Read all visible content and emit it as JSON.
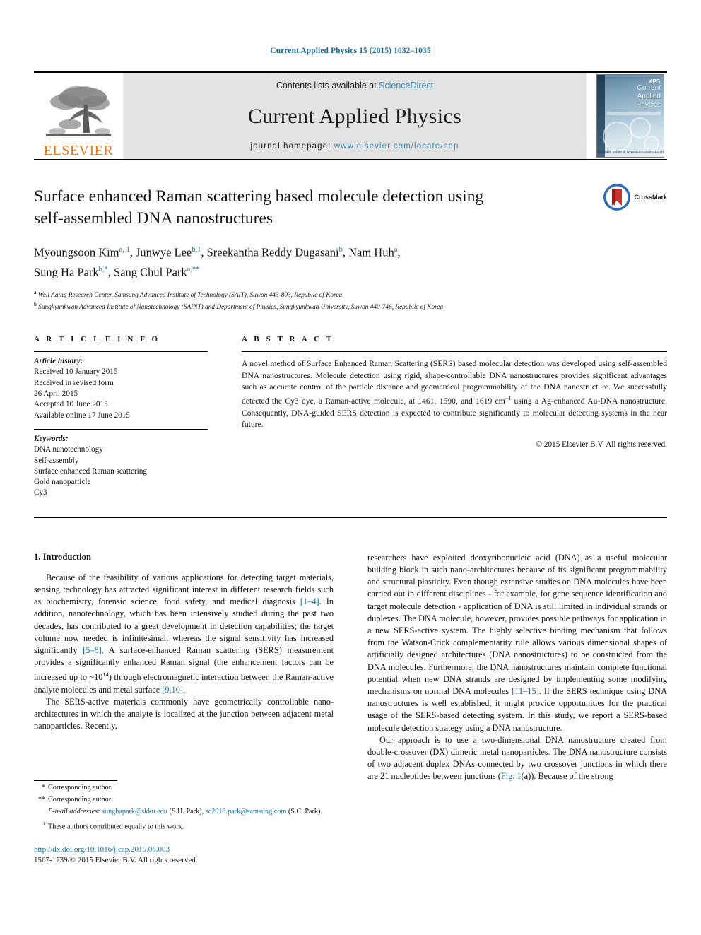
{
  "running_head": "Current Applied Physics 15 (2015) 1032–1035",
  "masthead": {
    "publisher_logo_text": "ELSEVIER",
    "contents_prefix": "Contents lists available at ",
    "contents_link": "ScienceDirect",
    "journal_name": "Current Applied Physics",
    "homepage_prefix": "journal homepage: ",
    "homepage_link": "www.elsevier.com/locate/cap",
    "cover": {
      "line1": "Current",
      "line2": "Applied",
      "line3": "Physics",
      "badge": "KPS",
      "footer": "Available online at www.sciencedirect.com"
    }
  },
  "article": {
    "title_line1": "Surface enhanced Raman scattering based molecule detection using",
    "title_line2": "self-assembled DNA nanostructures",
    "crossmark_label": "CrossMark",
    "authors_line1_parts": [
      {
        "name": "Myoungsoon Kim",
        "sup": "a, 1"
      },
      {
        "name": "Junwye Lee",
        "sup": "b,1"
      },
      {
        "name": "Sreekantha Reddy Dugasani",
        "sup": "b"
      },
      {
        "name": "Nam Huh",
        "sup": "a"
      }
    ],
    "authors_line2_parts": [
      {
        "name": "Sung Ha Park",
        "sup": "b,*"
      },
      {
        "name": "Sang Chul Park",
        "sup": "a,**"
      }
    ],
    "affiliations": [
      {
        "mark": "a",
        "text": "Well Aging Research Center, Samsung Advanced Institute of Technology (SAIT), Suwon 443-803, Republic of Korea"
      },
      {
        "mark": "b",
        "text": "Sungkyunkwan Advanced Institute of Nanotechnology (SAINT) and Department of Physics, Sungkyunkwan University, Suwon 440-746, Republic of Korea"
      }
    ]
  },
  "article_info": {
    "heading": "A R T I C L E   I N F O",
    "history_label": "Article history:",
    "history": [
      "Received 10 January 2015",
      "Received in revised form",
      "26 April 2015",
      "Accepted 10 June 2015",
      "Available online 17 June 2015"
    ],
    "keywords_label": "Keywords:",
    "keywords": [
      "DNA nanotechnology",
      "Self-assembly",
      "Surface enhanced Raman scattering",
      "Gold nanoparticle",
      "Cy3"
    ]
  },
  "abstract": {
    "heading": "A B S T R A C T",
    "text_part1": "A novel method of Surface Enhanced Raman Scattering (SERS) based molecular detection was developed using self-assembled DNA nanostructures. Molecule detection using rigid, shape-controllable DNA nanostructures provides significant advantages such as accurate control of the particle distance and geometrical programmability of the DNA nanostructure. We successfully detected the Cy3 dye, a Raman-active molecule, at 1461, 1590, and 1619 cm",
    "superscript": "−1",
    "text_part2": " using a Ag-enhanced Au-DNA nanostructure. Consequently, DNA-guided SERS detection is expected to contribute significantly to molecular detecting systems in the near future.",
    "copyright": "© 2015 Elsevier B.V. All rights reserved."
  },
  "body": {
    "section_title": "1. Introduction",
    "left_paragraph_1_a": "Because of the feasibility of various applications for detecting target materials, sensing technology has attracted significant interest in different research fields such as biochemistry, forensic science, food safety, and medical diagnosis ",
    "left_ref_1": "[1–4]",
    "left_paragraph_1_b": ". In addition, nanotechnology, which has been intensively studied during the past two decades, has contributed to a great development in detection capabilities; the target volume now needed is infinitesimal, whereas the signal sensitivity has increased significantly ",
    "left_ref_2": "[5–8]",
    "left_paragraph_1_c": ". A surface-enhanced Raman scattering (SERS) measurement provides a significantly enhanced Raman signal (the enhancement factors can be increased up to ~10",
    "left_exponent": "14",
    "left_paragraph_1_d": ") through electromagnetic interaction between the Raman-active analyte molecules and metal surface ",
    "left_ref_3": "[9,10]",
    "left_paragraph_1_e": ".",
    "left_paragraph_2": "The SERS-active materials commonly have geometrically controllable nano-architectures in which the analyte is localized at the junction between adjacent metal nanoparticles. Recently,",
    "right_paragraph_1_a": "researchers have exploited deoxyribonucleic acid (DNA) as a useful molecular building block in such nano-architectures because of its significant programmability and structural plasticity. Even though extensive studies on DNA molecules have been carried out in different disciplines - for example, for gene sequence identification and target molecule detection - application of DNA is still limited in individual strands or duplexes. The DNA molecule, however, provides possible pathways for application in a new SERS-active system. The highly selective binding mechanism that follows from the Watson-Crick complementarity rule allows various dimensional shapes of artificially designed architectures (DNA nanostructures) to be constructed from the DNA molecules. Furthermore, the DNA nanostructures maintain complete functional potential when new DNA strands are designed by implementing some modifying mechanisms on normal DNA molecules ",
    "right_ref_1": "[11–15]",
    "right_paragraph_1_b": ". If the SERS technique using DNA nanostructures is well established, it might provide opportunities for the practical usage of the SERS-based detecting system. In this study, we report a SERS-based molecule detection strategy using a DNA nanostructure.",
    "right_paragraph_2_a": "Our approach is to use a two-dimensional DNA nanostructure created from double-crossover (DX) dimeric metal nanoparticles. The DNA nanostructure consists of two adjacent duplex DNAs connected by two crossover junctions in which there are 21 nucleotides between junctions (",
    "right_ref_2": "Fig. 1",
    "right_paragraph_2_b": "(a)). Because of the strong"
  },
  "footnotes": {
    "corresponding_1_mark": "*",
    "corresponding_1": "Corresponding author.",
    "corresponding_2_mark": "**",
    "corresponding_2": "Corresponding author.",
    "email_label": "E-mail addresses:",
    "email_1": "sunghapark@skku.edu",
    "email_1_owner": "(S.H. Park)",
    "email_2": "sc2013.park@samsung.com",
    "email_2_owner": "(S.C. Park).",
    "equal_mark": "1",
    "equal_contrib": "These authors contributed equally to this work.",
    "doi": "http://dx.doi.org/10.1016/j.cap.2015.06.003",
    "issn": "1567-1739/© 2015 Elsevier B.V. All rights reserved."
  },
  "colors": {
    "link_blue": "#1a6c9c",
    "sciencedirect_blue": "#3c8dbc",
    "elsevier_orange": "#E87722",
    "masthead_grey": "#e3e3e3"
  }
}
